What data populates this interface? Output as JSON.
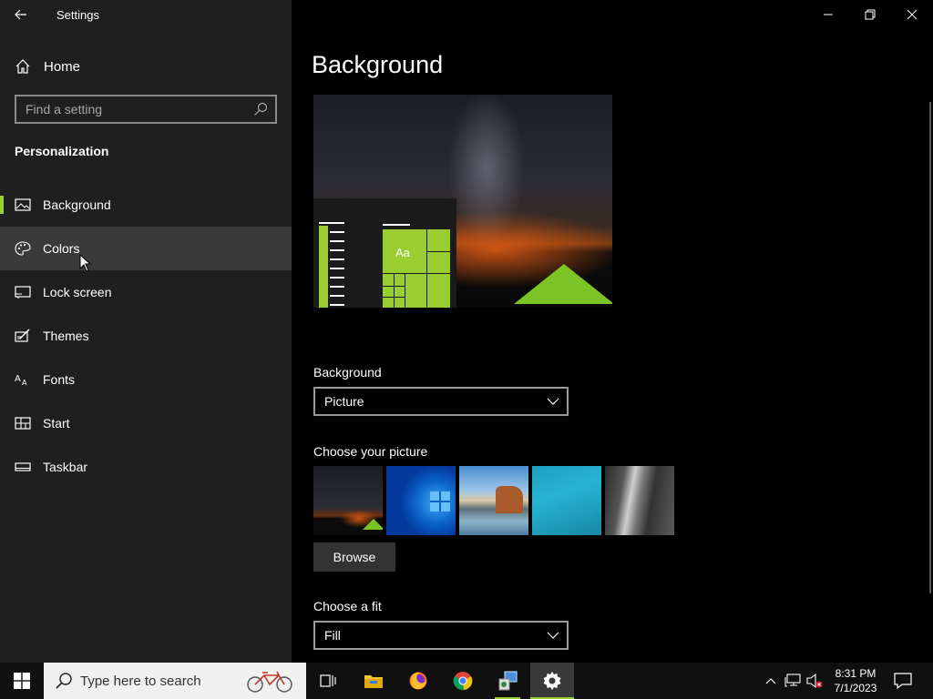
{
  "window": {
    "title": "Settings",
    "back_label": "←"
  },
  "sidebar": {
    "home_label": "Home",
    "search_placeholder": "Find a setting",
    "section_title": "Personalization",
    "items": [
      {
        "label": "Background",
        "icon": "picture-icon",
        "selected": true
      },
      {
        "label": "Colors",
        "icon": "palette-icon",
        "hover": true
      },
      {
        "label": "Lock screen",
        "icon": "lock-screen-icon"
      },
      {
        "label": "Themes",
        "icon": "themes-icon"
      },
      {
        "label": "Fonts",
        "icon": "fonts-icon"
      },
      {
        "label": "Start",
        "icon": "start-icon"
      },
      {
        "label": "Taskbar",
        "icon": "taskbar-icon"
      }
    ]
  },
  "main": {
    "page_title": "Background",
    "preview": {
      "tile_label": "Aa"
    },
    "background_label": "Background",
    "background_value": "Picture",
    "choose_picture_label": "Choose your picture",
    "pictures": [
      "milky-way-tent",
      "windows-blue",
      "beach-rocks",
      "underwater-swimmer",
      "rock-cliff"
    ],
    "browse_label": "Browse",
    "fit_label": "Choose a fit",
    "fit_value": "Fill"
  },
  "taskbar": {
    "search_placeholder": "Type here to search",
    "apps": [
      "task-view-icon",
      "file-explorer-icon",
      "firefox-icon",
      "chrome-icon",
      "control-panel-icon",
      "settings-gear-icon"
    ],
    "clock_time": "8:31 PM",
    "clock_date": "7/1/2023"
  },
  "colors": {
    "accent": "#9acd32",
    "sidebar_bg": "#1f1f1f",
    "main_bg": "#000000",
    "hover_bg": "#3a3a3a"
  }
}
